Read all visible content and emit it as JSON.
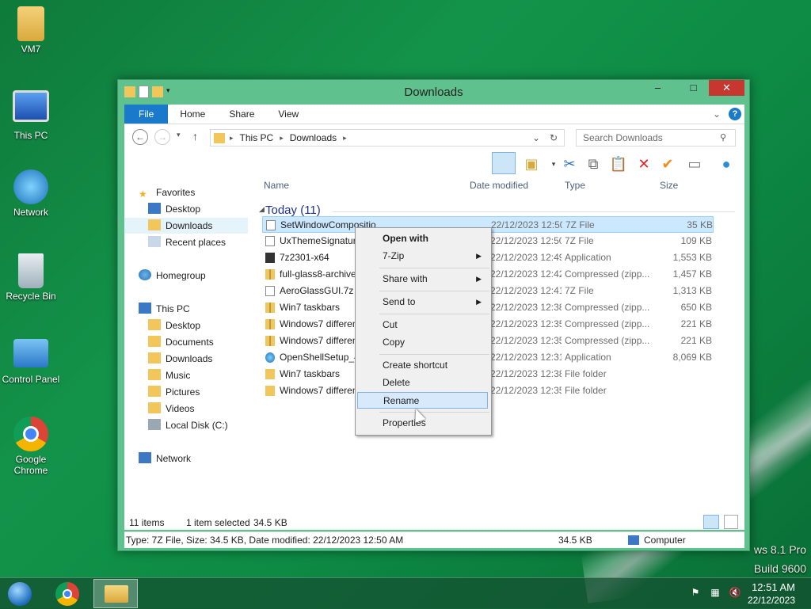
{
  "desktop": {
    "icons": [
      {
        "label": "VM7",
        "icon": "user-folder-icon"
      },
      {
        "label": "This PC",
        "icon": "computer-icon"
      },
      {
        "label": "Network",
        "icon": "network-icon"
      },
      {
        "label": "Recycle Bin",
        "icon": "recycle-bin-icon"
      },
      {
        "label": "Control Panel",
        "icon": "control-panel-icon"
      },
      {
        "label": "Google Chrome",
        "icon": "chrome-icon"
      }
    ],
    "watermark": [
      "ws 8.1 Pro",
      "Build 9600"
    ]
  },
  "window": {
    "title": "Downloads",
    "tabs": [
      "File",
      "Home",
      "Share",
      "View"
    ],
    "breadcrumb": [
      "This PC",
      "Downloads"
    ],
    "search_placeholder": "Search Downloads",
    "nav": {
      "favorites": "Favorites",
      "favorites_items": [
        "Desktop",
        "Downloads",
        "Recent places"
      ],
      "homegroup": "Homegroup",
      "thispc": "This PC",
      "thispc_items": [
        "Desktop",
        "Documents",
        "Downloads",
        "Music",
        "Pictures",
        "Videos",
        "Local Disk (C:)"
      ],
      "network": "Network"
    },
    "columns": {
      "name": "Name",
      "date": "Date modified",
      "type": "Type",
      "size": "Size"
    },
    "group": "Today (11)",
    "files": [
      {
        "name": "SetWindowCompositionAttribute",
        "date": "22/12/2023 12:50 ...",
        "type": "7Z File",
        "size": "35 KB",
        "icon": "7z"
      },
      {
        "name": "UxThemeSignatureBypass",
        "date": "22/12/2023 12:50 ...",
        "type": "7Z File",
        "size": "109 KB",
        "icon": "7z"
      },
      {
        "name": "7z2301-x64",
        "date": "22/12/2023 12:49 ...",
        "type": "Application",
        "size": "1,553 KB",
        "icon": "exe"
      },
      {
        "name": "full-glass8-archive",
        "date": "22/12/2023 12:42 ...",
        "type": "Compressed (zipp...",
        "size": "1,457 KB",
        "icon": "zip"
      },
      {
        "name": "AeroGlassGUI.7z",
        "date": "22/12/2023 12:41 ...",
        "type": "7Z File",
        "size": "1,313 KB",
        "icon": "7z"
      },
      {
        "name": "Win7 taskbars",
        "date": "22/12/2023 12:38 ...",
        "type": "Compressed (zipp...",
        "size": "650 KB",
        "icon": "zip"
      },
      {
        "name": "Windows7 difference",
        "date": "22/12/2023 12:35 ...",
        "type": "Compressed (zipp...",
        "size": "221 KB",
        "icon": "zip"
      },
      {
        "name": "Windows7 difference",
        "date": "22/12/2023 12:35 ...",
        "type": "Compressed (zipp...",
        "size": "221 KB",
        "icon": "zip"
      },
      {
        "name": "OpenShellSetup_4",
        "date": "22/12/2023 12:31 ...",
        "type": "Application",
        "size": "8,069 KB",
        "icon": "setup"
      },
      {
        "name": "Win7 taskbars",
        "date": "22/12/2023 12:38 ...",
        "type": "File folder",
        "size": "",
        "icon": "folder"
      },
      {
        "name": "Windows7 difference",
        "date": "22/12/2023 12:35 ...",
        "type": "File folder",
        "size": "",
        "icon": "folder"
      }
    ],
    "status": {
      "items": "11 items",
      "selected": "1 item selected",
      "selsize": "34.5 KB"
    },
    "details": {
      "info": "Type: 7Z File, Size: 34.5 KB, Date modified: 22/12/2023 12:50 AM",
      "size": "34.5 KB",
      "location": "Computer"
    }
  },
  "context_menu": {
    "items": [
      "Open with",
      "7-Zip",
      "Share with",
      "Send to",
      "Cut",
      "Copy",
      "Create shortcut",
      "Delete",
      "Rename",
      "Properties"
    ],
    "hovered": "Rename"
  },
  "taskbar": {
    "time": "12:51 AM",
    "date": "22/12/2023"
  },
  "colors": {
    "window_frame": "#5fc28e",
    "close": "#c7372f",
    "file_tab": "#1979ca",
    "selection": "#cce8ff",
    "menu_hover": "#d7e9fb"
  }
}
